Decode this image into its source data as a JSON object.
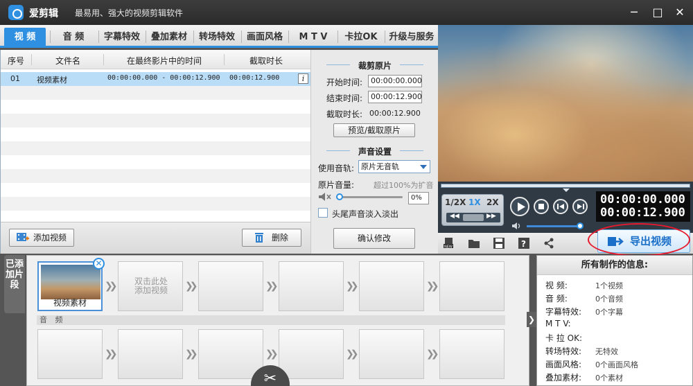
{
  "app": {
    "name": "爱剪辑",
    "slogan": "最易用、强大的视频剪辑软件",
    "minimize": "─",
    "maximize": "□",
    "close": "✕"
  },
  "tabs": [
    {
      "label": "视 频",
      "active": true
    },
    {
      "label": "音 频"
    },
    {
      "label": "字幕特效"
    },
    {
      "label": "叠加素材"
    },
    {
      "label": "转场特效"
    },
    {
      "label": "画面风格"
    },
    {
      "label": "M T V"
    },
    {
      "label": "卡拉OK"
    },
    {
      "label": "升级与服务"
    }
  ],
  "clip_list": {
    "headers": [
      "序号",
      "文件名",
      "在最终影片中的时间",
      "截取时长"
    ],
    "rows": [
      {
        "index": "01",
        "name": "视频素材",
        "time_range": "00:00:00.000 - 00:00:12.900",
        "duration": "00:00:12.900",
        "info": "i"
      }
    ],
    "add_button": "添加视频",
    "delete_button": "删除"
  },
  "trim": {
    "title": "裁剪原片",
    "start_label": "开始时间:",
    "start_value": "00:00:00.000",
    "end_label": "结束时间:",
    "end_value": "00:00:12.900",
    "duration_label": "截取时长:",
    "duration_value": "00:00:12.900",
    "preview_button": "预览/截取原片"
  },
  "sound": {
    "title": "声音设置",
    "track_label": "使用音轨:",
    "track_value": "原片无音轨",
    "volume_label": "原片音量:",
    "volume_hint": "超过100%为扩音",
    "volume_value": "0%",
    "fade_label": "头尾声音淡入淡出",
    "confirm_button": "确认修改"
  },
  "player": {
    "speeds": [
      "1/2X",
      "1X",
      "2X"
    ],
    "current_time": "00:00:00.000",
    "total_time": "00:00:12.900",
    "volume_level": 0.9,
    "export_button": "导出视频",
    "accent": "#2f8fe0",
    "highlight_circle_color": "#e8192c"
  },
  "timeline": {
    "side_label": "已添加片段",
    "clips": [
      {
        "label": "视频素材",
        "selected": true
      },
      {
        "hint_line1": "双击此处",
        "hint_line2": "添加视频"
      }
    ],
    "audio_label": "音 频",
    "scissor": "✂"
  },
  "info": {
    "title": "所有制作的信息:",
    "items": [
      {
        "key": "视    频:",
        "value": "1个视频"
      },
      {
        "key": "音    频:",
        "value": "0个音频"
      },
      {
        "key": "字幕特效:",
        "value": "0个字幕"
      },
      {
        "key": "M  T  V:",
        "value": ""
      },
      {
        "key": "卡 拉 OK:",
        "value": ""
      },
      {
        "key": "转场特效:",
        "value": "无特效"
      },
      {
        "key": "画面风格:",
        "value": "0个画面风格"
      },
      {
        "key": "叠加素材:",
        "value": "0个素材"
      }
    ]
  }
}
